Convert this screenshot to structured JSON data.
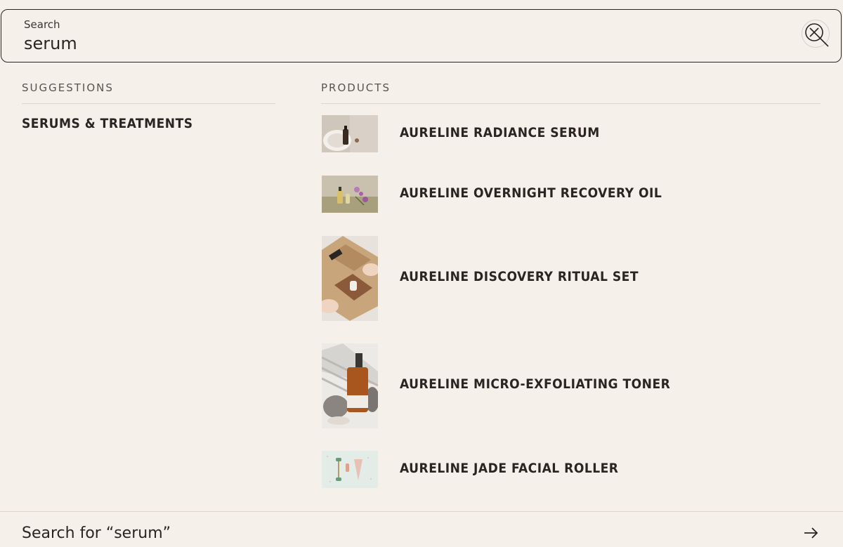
{
  "search": {
    "label": "Search",
    "value": "serum"
  },
  "suggestions": {
    "heading": "SUGGESTIONS",
    "items": [
      {
        "label": "Serums & Treatments"
      }
    ]
  },
  "products": {
    "heading": "PRODUCTS",
    "items": [
      {
        "name": "Aureline Radiance Serum",
        "thumbnail": "serum-bottle-on-dish-image"
      },
      {
        "name": "Aureline Overnight Recovery Oil",
        "thumbnail": "oil-bottles-with-flowers-image"
      },
      {
        "name": "Aureline Discovery Ritual Set",
        "thumbnail": "gift-box-with-bottle-image"
      },
      {
        "name": "Aureline Micro-Exfoliating Toner",
        "thumbnail": "amber-dropper-bottle-image"
      },
      {
        "name": "Aureline Jade Facial Roller",
        "thumbnail": "facial-rollers-image"
      }
    ]
  },
  "footer": {
    "search_for_label": "Search for “serum”"
  },
  "icons": {
    "clear": "close-icon",
    "submit": "arrow-right-icon"
  }
}
